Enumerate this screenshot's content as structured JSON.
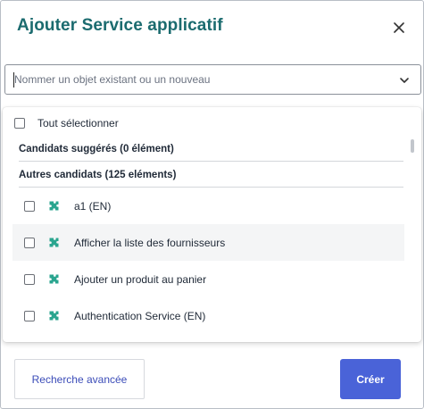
{
  "dialog": {
    "title": "Ajouter Service applicatif",
    "close_icon": "close-icon"
  },
  "search": {
    "placeholder": "Nommer un objet existant ou un nouveau",
    "value": "",
    "dropdown_icon": "chevron-down-icon"
  },
  "list": {
    "select_all_label": "Tout sélectionner",
    "suggested_header": "Candidats suggérés (0 élément)",
    "others_header": "Autres candidats (125 eléments)",
    "item_icon": "puzzle-icon",
    "items": [
      {
        "label": "a1 (EN)"
      },
      {
        "label": "Afficher la liste des fournisseurs"
      },
      {
        "label": "Ajouter un produit au panier"
      },
      {
        "label": "Authentication Service (EN)"
      }
    ]
  },
  "footer": {
    "advanced_search_label": "Recherche avancée",
    "create_label": "Créer"
  },
  "colors": {
    "title": "#1b6b6f",
    "primary_button": "#4a63d8",
    "link_text": "#3b4cb8",
    "puzzle_icon": "#2aa58f"
  }
}
